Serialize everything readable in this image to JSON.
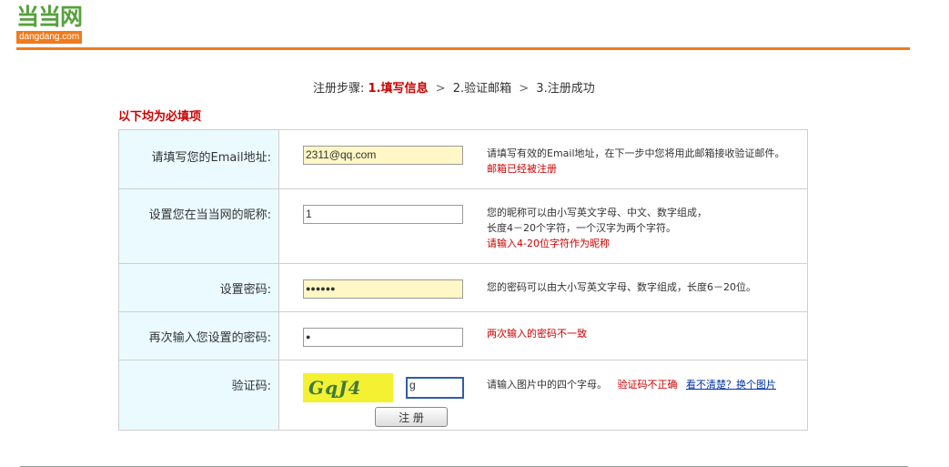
{
  "logo": {
    "mark": "当当网",
    "sub": "dangdang.com"
  },
  "steps": {
    "prefix": "注册步骤:",
    "step1": "1.填写信息",
    "arrow": ">",
    "step2": "2.验证邮箱",
    "step3": "3.注册成功"
  },
  "required_title": "以下均为必填项",
  "form": {
    "email": {
      "label": "请填写您的Email地址:",
      "value": "2311@qq.com",
      "hint": "请填写有效的Email地址，在下一步中您将用此邮箱接收验证邮件。",
      "error": "邮箱已经被注册"
    },
    "nickname": {
      "label": "设置您在当当网的昵称:",
      "value": "1",
      "hint1": "您的昵称可以由小写英文字母、中文、数字组成，",
      "hint2": "长度4－20个字符，一个汉字为两个字符。",
      "error": "请输入4-20位字符作为昵称"
    },
    "password": {
      "label": "设置密码:",
      "value": "●●●●●●",
      "hint": "您的密码可以由大小写英文字母、数字组成，长度6－20位。"
    },
    "confirm": {
      "label": "再次输入您设置的密码:",
      "value": "●",
      "error": "两次输入的密码不一致"
    },
    "captcha": {
      "label": "验证码:",
      "image_text": "GqJ4",
      "value": "g",
      "hint": "请输入图片中的四个字母。",
      "error": "验证码不正确",
      "link": "看不清楚？换个图片"
    }
  },
  "submit_label": "注 册",
  "colors": {
    "accent": "#ef7b1d",
    "brand": "#57a13d",
    "error": "#cc0000",
    "label_bg": "#eafaff",
    "warn_bg": "#fff7c5"
  }
}
